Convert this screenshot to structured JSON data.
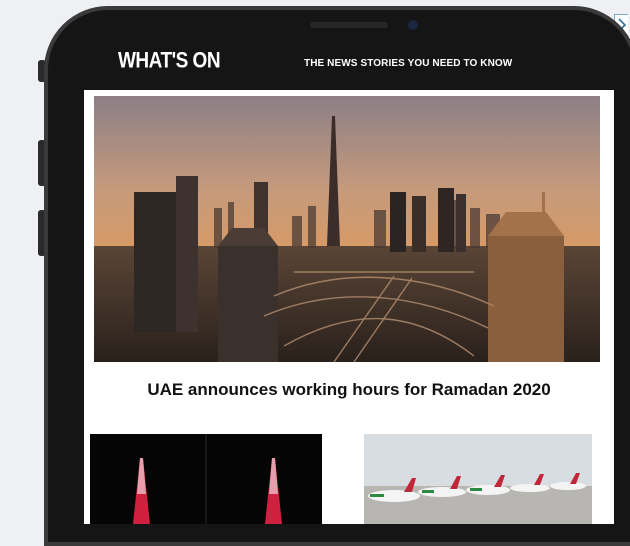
{
  "app": {
    "logo": "WHAT'S ON",
    "tagline": "THE NEWS STORIES YOU NEED TO KNOW"
  },
  "feature": {
    "headline": "UAE announces working hours for Ramadan 2020",
    "image": "dubai-skyline-photo"
  },
  "stories": [
    {
      "image": "burj-khalifa-night-photo"
    },
    {
      "image": "emirates-planes-photo"
    }
  ],
  "ad_choices": {
    "icon": "chevron-right-icon"
  },
  "colors": {
    "header_bg": "#000000",
    "text": "#111111",
    "ad_choices": "#2f6fa8"
  }
}
